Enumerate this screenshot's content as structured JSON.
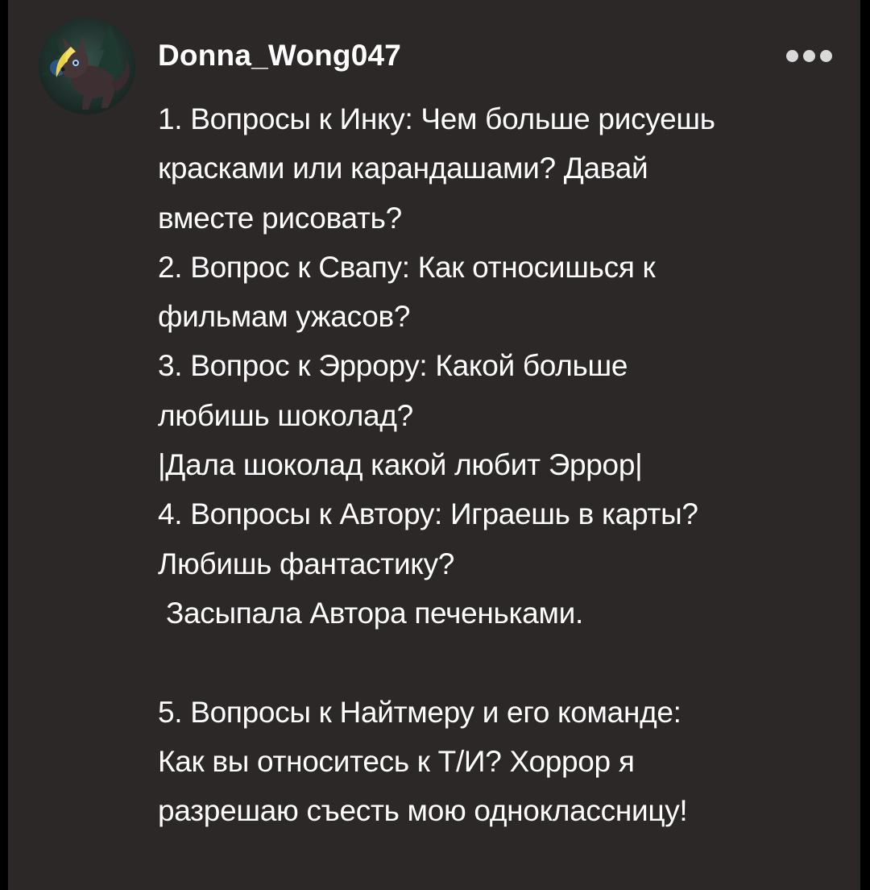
{
  "post": {
    "author": {
      "username": "Donna_Wong047",
      "avatar_icon": "wolf-avatar-icon"
    },
    "menu": {
      "icon": "more-horizontal-icon"
    },
    "message_lines": [
      "1. Вопросы к Инку: Чем больше рисуешь",
      "красками или карандашами? Давай",
      "вместе рисовать?",
      "2. Вопрос к Свапу: Как относишься к",
      "фильмам ужасов?",
      "3. Вопрос к Эррору: Какой больше",
      "любишь шоколад?",
      "|Дала шоколад какой любит Эррор|",
      "4. Вопросы к Автору: Играешь в карты?",
      "Любишь фантастику?",
      " Засыпала Автора печеньками.",
      "",
      "5. Вопросы к Найтмеру и его команде:",
      "Как вы относитесь к Т/И? Хоррор я",
      "разрешаю съесть мою одноклассницу!"
    ]
  },
  "colors": {
    "background": "#000000",
    "card": "#2c2827",
    "text": "#ffffff",
    "dots": "#d9d9d9"
  }
}
